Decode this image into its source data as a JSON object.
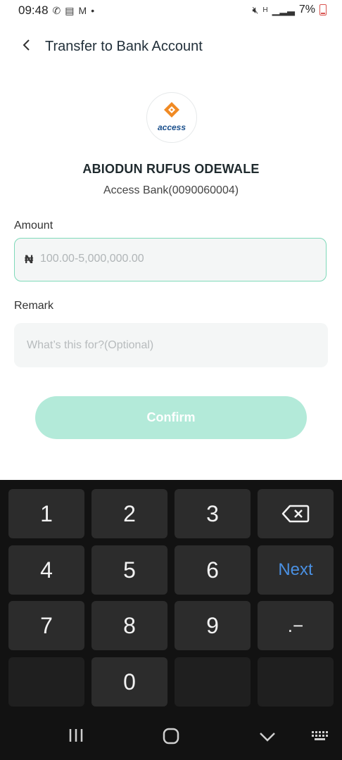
{
  "status_bar": {
    "time": "09:48",
    "battery": "7%",
    "left_icons": [
      "phone-icon",
      "message-icon",
      "gmail-icon",
      "dot-icon"
    ],
    "right_icons": [
      "mute-icon",
      "network-h-icon",
      "signal-icon",
      "battery-icon"
    ]
  },
  "header": {
    "title": "Transfer to Bank Account",
    "back_icon": "chevron-left-icon"
  },
  "recipient": {
    "logo_text": "access",
    "name": "ABIODUN RUFUS ODEWALE",
    "bank": "Access Bank(0090060004)"
  },
  "form": {
    "amount_label": "Amount",
    "currency_symbol": "₦",
    "amount_placeholder": "100.00-5,000,000.00",
    "remark_label": "Remark",
    "remark_placeholder": "What’s this for?(Optional)",
    "confirm_label": "Confirm"
  },
  "keyboard": {
    "keys": [
      "1",
      "2",
      "3",
      "4",
      "5",
      "6",
      "7",
      "8",
      "9",
      "0"
    ],
    "next_label": "Next",
    "dot_dash_label": ".−",
    "backspace_icon": "backspace-icon"
  },
  "navbar": {
    "recent_icon": "recents-icon",
    "home_icon": "home-icon",
    "hide_keyboard_icon": "chevron-down-icon",
    "keyboard_icon": "keyboard-icon"
  },
  "colors": {
    "accent": "#7fd9b9",
    "confirm_bg": "#b3ead9",
    "next_blue": "#4a90e2",
    "logo_orange": "#f08a24",
    "logo_blue": "#1a4f8c"
  }
}
